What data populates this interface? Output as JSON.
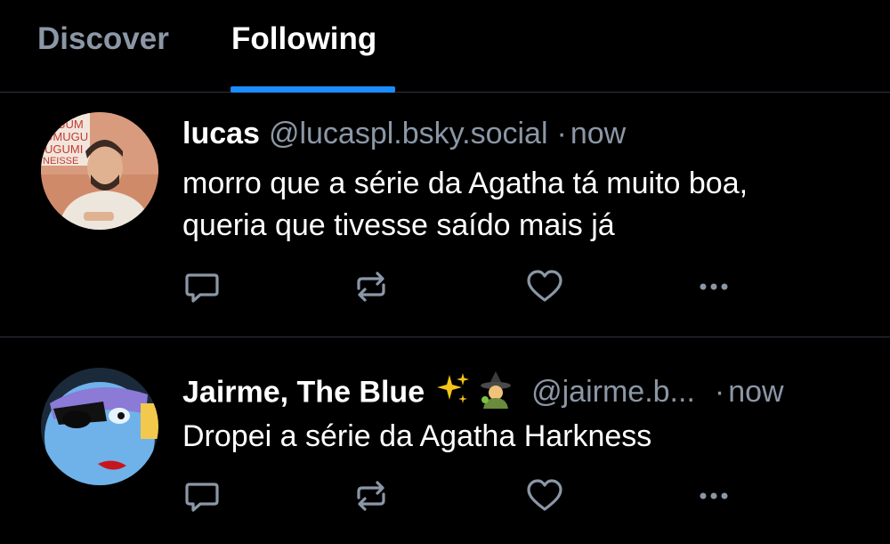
{
  "tabs": {
    "discover": "Discover",
    "following": "Following",
    "active": "Following"
  },
  "colors": {
    "background": "#000000",
    "accent": "#1d8cff",
    "muted": "#8b97a6",
    "divider": "#2e3640"
  },
  "posts": [
    {
      "author": "lucas",
      "handle": "@lucaspl.bsky.social",
      "separator": "·",
      "time": "now",
      "text_line1": "morro que a série da Agatha tá muito boa,",
      "text_line2": "queria que tivesse saído mais já",
      "actions": [
        "reply-icon",
        "repost-icon",
        "heart-icon",
        "more-icon"
      ]
    },
    {
      "author": "Jairme, The Blue",
      "author_emojis": [
        "sparkles-emoji",
        "witch-emoji"
      ],
      "handle": "@jairme.b...",
      "separator": "·",
      "time": "now",
      "text_line1": "Dropei a série da Agatha Harkness",
      "actions": [
        "reply-icon",
        "repost-icon",
        "heart-icon",
        "more-icon"
      ]
    }
  ]
}
